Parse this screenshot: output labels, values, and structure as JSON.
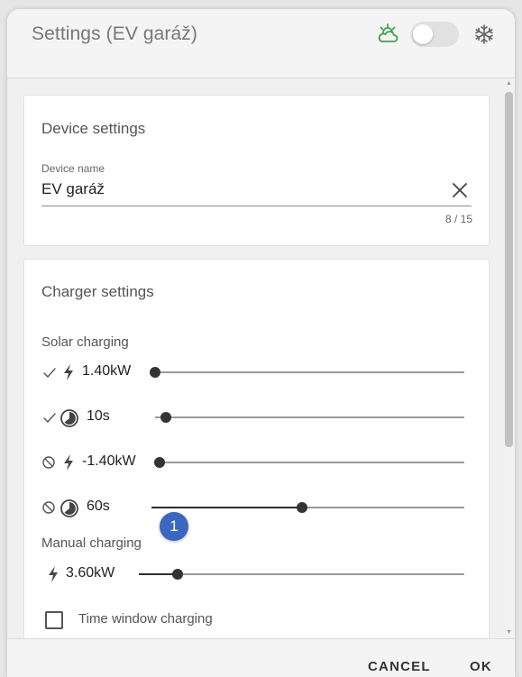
{
  "header": {
    "title": "Settings (EV garáž)",
    "toggle_on": false,
    "weather_icon": "sun-cloud-icon",
    "snowflake_icon": "snowflake-icon",
    "weather_icon_color": "#3aa44a"
  },
  "device_settings": {
    "title": "Device settings",
    "name_label": "Device name",
    "name_value": "EV garáž",
    "counter": "8 / 15"
  },
  "charger_settings": {
    "title": "Charger settings",
    "solar_label": "Solar charging",
    "solar_rows": [
      {
        "state_icon": "check-icon",
        "type_icon": "bolt-icon",
        "value": "1.40kW",
        "slider_fraction": 0.0
      },
      {
        "state_icon": "check-icon",
        "type_icon": "timer-icon",
        "value": "10s",
        "slider_fraction": 0.0
      },
      {
        "state_icon": "block-icon",
        "type_icon": "bolt-icon",
        "value": "-1.40kW",
        "slider_fraction": 0.0
      },
      {
        "state_icon": "block-icon",
        "type_icon": "timer-icon",
        "value": "60s",
        "slider_fraction": 0.48
      }
    ],
    "badge": "1",
    "manual_label": "Manual charging",
    "manual_row": {
      "type_icon": "bolt-icon",
      "value": "3.60kW",
      "slider_fraction": 0.12
    },
    "time_window_label": "Time window charging",
    "time_window_checked": false
  },
  "footer": {
    "cancel_label": "CANCEL",
    "ok_label": "OK"
  },
  "colors": {
    "accent": "#3a67bf",
    "slider": "#333333"
  }
}
